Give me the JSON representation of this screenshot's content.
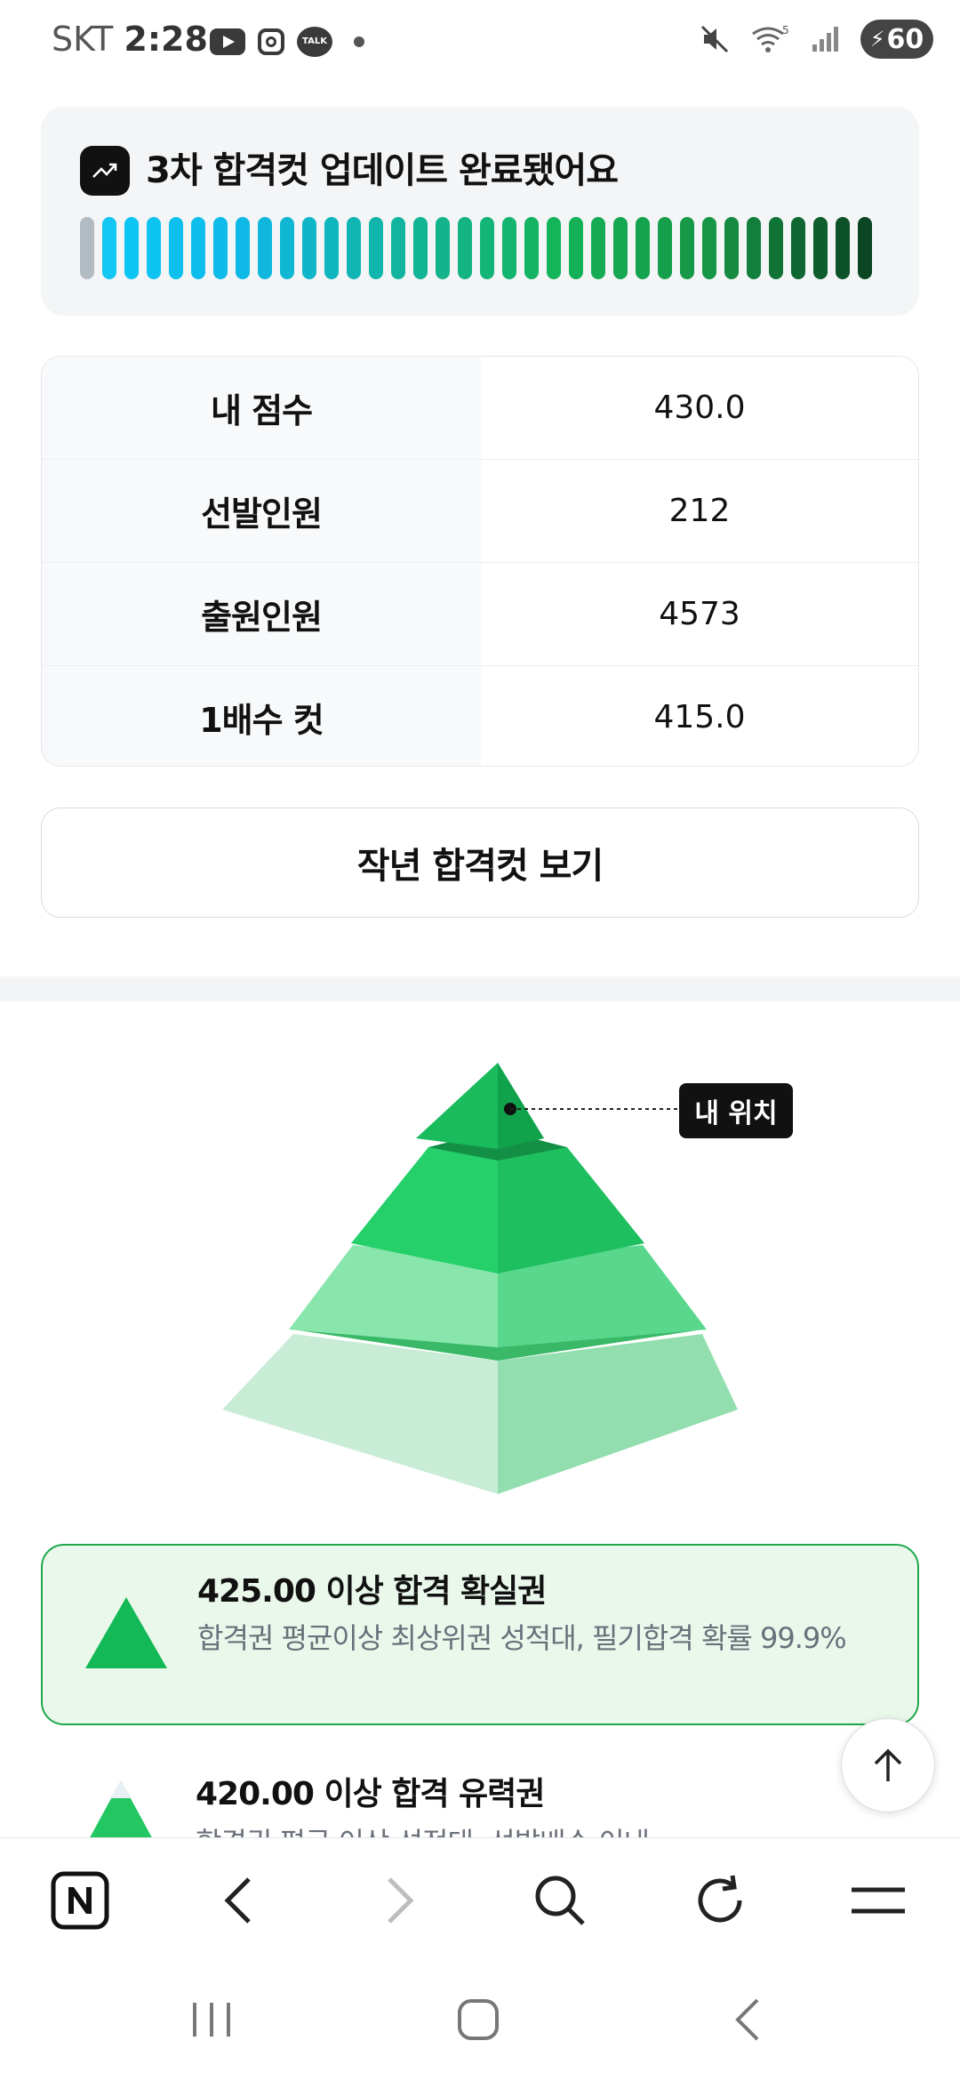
{
  "status_bar": {
    "carrier": "SKT",
    "time": "2:28",
    "talk_badge": "TALK",
    "network": "5",
    "battery": "60"
  },
  "notice": {
    "title": "3차 합격컷 업데이트 완료됐어요",
    "icon": "trending-up-icon",
    "progress": 1.0
  },
  "info_table": [
    {
      "label": "내 점수",
      "value": "430.0"
    },
    {
      "label": "선발인원",
      "value": "212"
    },
    {
      "label": "출원인원",
      "value": "4573"
    },
    {
      "label": "1배수 컷",
      "value": "415.0"
    }
  ],
  "prev_cut_button": "작년 합격컷 보기",
  "pyramid": {
    "marker_label": "내 위치"
  },
  "grades": [
    {
      "title": "425.00 이상 합격 확실권",
      "desc": "합격권 평균이상 최상위권 성적대, 필기합격 확률 99.9%"
    },
    {
      "title": "420.00 이상 합격 유력권",
      "desc": "합격권 평균 이상 성적대, 선발배수 이내"
    }
  ],
  "browser_bar": [
    "naver-n-icon",
    "back-icon",
    "forward-icon",
    "search-icon",
    "refresh-icon",
    "menu-icon"
  ],
  "colors": {
    "accent_green": "#1ea84a",
    "card_bg": "#f4f5f7",
    "grade_bg": "#eaf8ec"
  }
}
